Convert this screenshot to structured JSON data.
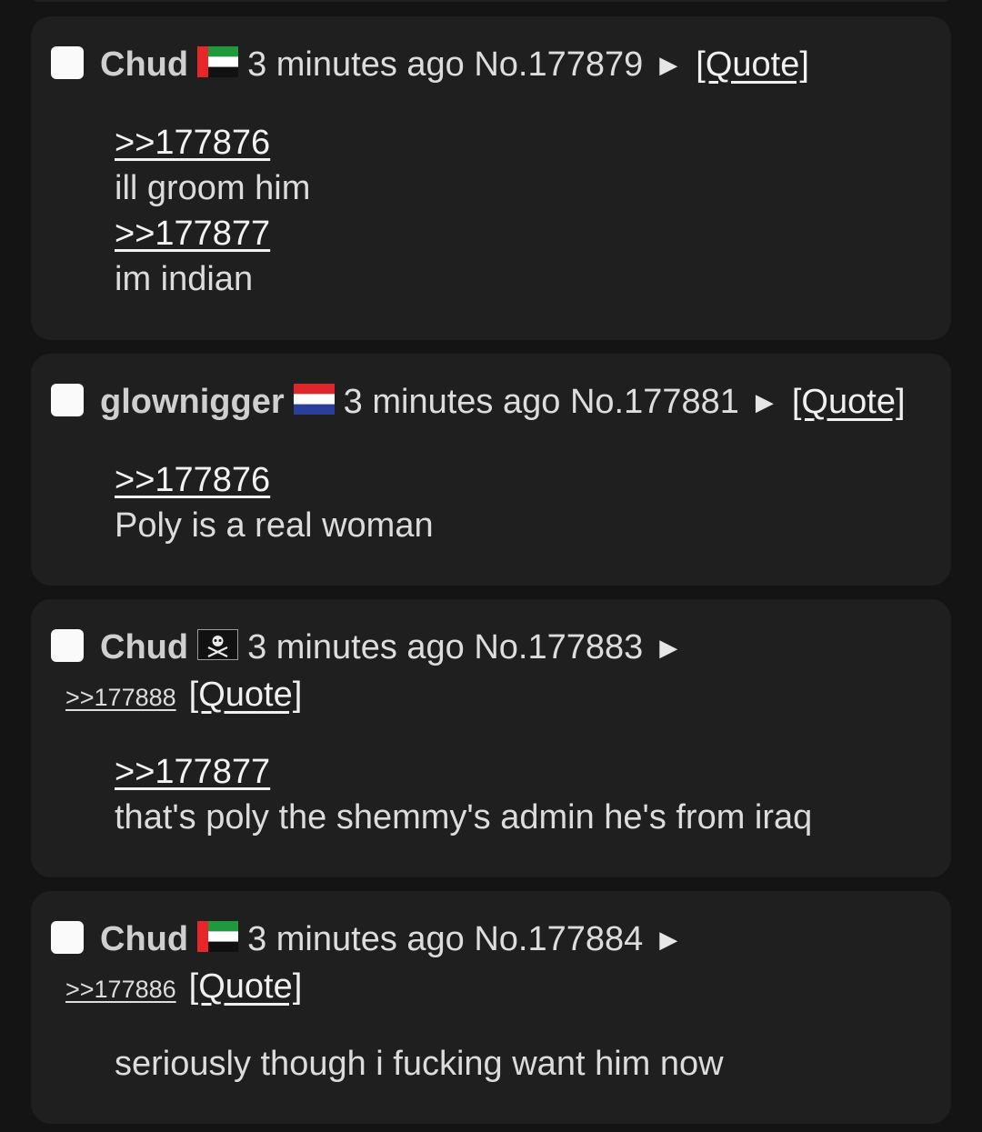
{
  "posts": [
    {
      "name": "Chud",
      "flag": "uae-flag",
      "time": "3 minutes ago",
      "number": "No.177879",
      "arrow": "▶",
      "quote_label": "[Quote]",
      "body": [
        {
          "ref": ">>177876"
        },
        {
          "text": "ill groom him"
        },
        {
          "ref": ">>177877"
        },
        {
          "text": "im indian"
        }
      ]
    },
    {
      "name": "glownigger",
      "flag": "netherlands-flag",
      "time": "3 minutes ago",
      "number": "No.177881",
      "arrow": "▶",
      "quote_label": "[Quote]",
      "body": [
        {
          "ref": ">>177876"
        },
        {
          "text": "Poly is a real woman"
        }
      ]
    },
    {
      "name": "Chud",
      "flag": "pirate-flag",
      "time": "3 minutes ago",
      "number": "No.177883",
      "arrow": "▶",
      "backlink": ">>177888",
      "quote_label": "[Quote]",
      "body": [
        {
          "ref": ">>177877"
        },
        {
          "text": "that's poly the shemmy's admin he's from iraq"
        }
      ]
    },
    {
      "name": "Chud",
      "flag": "uae-flag",
      "time": "3 minutes ago",
      "number": "No.177884",
      "arrow": "▶",
      "backlink": ">>177886",
      "quote_label": "[Quote]",
      "body": [
        {
          "text": "seriously though i fucking want him now"
        }
      ]
    }
  ]
}
